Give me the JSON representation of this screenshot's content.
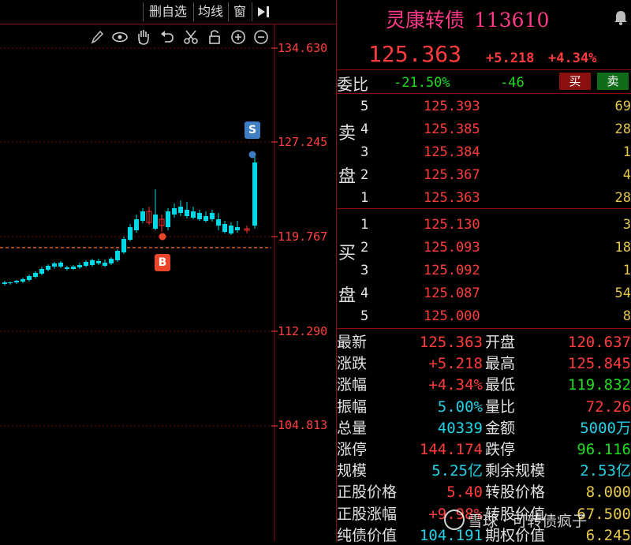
{
  "toolbar": {
    "delete_watchlist": "删自选",
    "ma_line": "均线",
    "window": "窗",
    "tools": [
      "pencil-icon",
      "eye-icon",
      "hand-icon",
      "undo-icon",
      "scissors-icon",
      "lock-icon",
      "zoom-in-icon",
      "zoom-out-icon"
    ]
  },
  "chart": {
    "price_levels": [
      "134.630",
      "127.245",
      "119.767",
      "112.290",
      "104.813"
    ],
    "marker_buy": "B",
    "marker_sell": "S",
    "colors": {
      "up": "#ff3030",
      "down": "#00d8e8",
      "grid": "#7a0a0a",
      "dash": "#ff7a2a"
    }
  },
  "header": {
    "name": "灵康转债",
    "code": "113610",
    "price": "125.363",
    "change": "+5.218",
    "change_pct": "+4.34%"
  },
  "weibi": {
    "label": "委比",
    "ratio": "-21.50%",
    "diff": "-46",
    "buy_btn": "买",
    "sell_btn": "卖"
  },
  "sell_side": {
    "label": [
      "卖",
      "盘"
    ],
    "rows": [
      {
        "level": "5",
        "price": "125.393",
        "vol": "69"
      },
      {
        "level": "4",
        "price": "125.385",
        "vol": "28"
      },
      {
        "level": "3",
        "price": "125.384",
        "vol": "1"
      },
      {
        "level": "2",
        "price": "125.367",
        "vol": "4"
      },
      {
        "level": "1",
        "price": "125.363",
        "vol": "28"
      }
    ]
  },
  "buy_side": {
    "label": [
      "买",
      "盘"
    ],
    "rows": [
      {
        "level": "1",
        "price": "125.130",
        "vol": "3"
      },
      {
        "level": "2",
        "price": "125.093",
        "vol": "18"
      },
      {
        "level": "3",
        "price": "125.092",
        "vol": "1"
      },
      {
        "level": "4",
        "price": "125.087",
        "vol": "54"
      },
      {
        "level": "5",
        "price": "125.000",
        "vol": "8"
      }
    ]
  },
  "stats": [
    {
      "l1": "最新",
      "v1": "125.363",
      "c1": "red",
      "l2": "开盘",
      "v2": "120.637",
      "c2": "red"
    },
    {
      "l1": "涨跌",
      "v1": "+5.218",
      "c1": "red",
      "l2": "最高",
      "v2": "125.845",
      "c2": "red"
    },
    {
      "l1": "涨幅",
      "v1": "+4.34%",
      "c1": "red",
      "l2": "最低",
      "v2": "119.832",
      "c2": "green"
    },
    {
      "l1": "振幅",
      "v1": "5.00%",
      "c1": "cyan",
      "l2": "量比",
      "v2": "72.26",
      "c2": "red"
    },
    {
      "l1": "总量",
      "v1": "40339",
      "c1": "cyan",
      "l2": "金额",
      "v2": "5000万",
      "c2": "cyan"
    },
    {
      "l1": "涨停",
      "v1": "144.174",
      "c1": "red",
      "l2": "跌停",
      "v2": "96.116",
      "c2": "green"
    },
    {
      "l1": "规模",
      "v1": "5.25亿",
      "c1": "cyan",
      "l2": "剩余规模",
      "v2": "2.53亿",
      "c2": "cyan"
    },
    {
      "l1": "正股价格",
      "v1": "5.40",
      "c1": "red",
      "l2": "转股价格",
      "v2": "8.000",
      "c2": "gold"
    },
    {
      "l1": "正股涨幅",
      "v1": "+9.98%",
      "c1": "red",
      "l2": "转股价值",
      "v2": "67.500",
      "c2": "gold"
    },
    {
      "l1": "纯债价值",
      "v1": "104.191",
      "c1": "cyan",
      "l2": "期权价值",
      "v2": "6.245",
      "c2": "gold"
    }
  ],
  "watermark": "雪球 · 可转债疯子"
}
